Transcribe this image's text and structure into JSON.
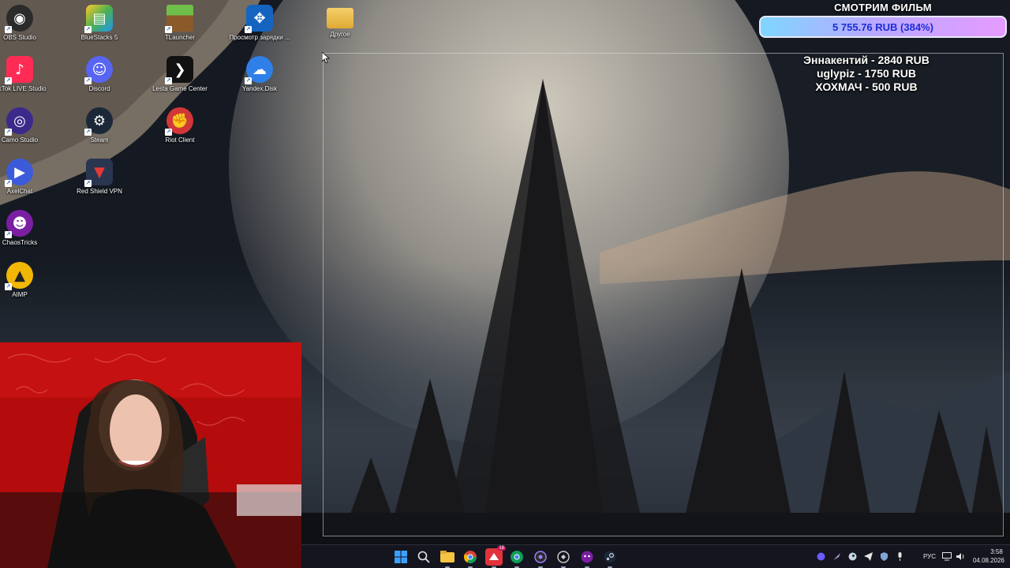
{
  "desktop": {
    "icons": [
      {
        "label": "OBS Studio",
        "icon": "obs-icon",
        "color": "#2b2b2b"
      },
      {
        "label": "BlueStacks 5",
        "icon": "bluestacks-icon",
        "color": "#4caf50"
      },
      {
        "label": "TLauncher",
        "icon": "tlauncher-icon",
        "color": "#5d8a3a"
      },
      {
        "label": "Просмотр зарядки ...",
        "icon": "controller-battery-icon",
        "color": "#1565c0"
      },
      {
        "label": "Другое",
        "icon": "folder-icon",
        "color": "#e8b84a"
      },
      {
        "label": "TikTok LIVE Studio",
        "icon": "tiktok-icon",
        "color": "#fe2c55"
      },
      {
        "label": "Discord",
        "icon": "discord-icon",
        "color": "#5865f2"
      },
      {
        "label": "Lesta Game Center",
        "icon": "lesta-icon",
        "color": "#111111"
      },
      {
        "label": "Yandex.Disk",
        "icon": "yandex-disk-icon",
        "color": "#2f7fe8"
      },
      {
        "label": "Camo Studio",
        "icon": "camo-icon",
        "color": "#3b2a8a"
      },
      {
        "label": "Steam",
        "icon": "steam-icon",
        "color": "#1b2838"
      },
      {
        "label": "Riot Client",
        "icon": "riot-icon",
        "color": "#d13639"
      },
      {
        "label": "AxelChat",
        "icon": "axelchat-icon",
        "color": "#3b5bdb"
      },
      {
        "label": "Red Shield VPN",
        "icon": "red-shield-icon",
        "color": "#c62828"
      },
      {
        "label": "ChaosTricks",
        "icon": "chaostricks-icon",
        "color": "#7b1fa2"
      },
      {
        "label": "AIMP",
        "icon": "aimp-icon",
        "color": "#f2b705"
      }
    ]
  },
  "overlay": {
    "goal_title": "СМОТРИМ ФИЛЬМ",
    "goal_amount": "5 755.76 RUB (384%)",
    "donors": [
      "Эннакентий - 2840 RUB",
      "uglypiz - 1750 RUB",
      "ХОХМАЧ - 500 RUB"
    ]
  },
  "taskbar": {
    "apps": [
      "start-icon",
      "search-icon",
      "file-explorer-icon",
      "chrome-icon",
      "streaming-app-icon",
      "chrome-alt-icon",
      "obs-icon",
      "app-icon",
      "chaostricks-icon",
      "steam-icon"
    ],
    "badge": "18",
    "tray": [
      "ai-app-icon",
      "feather-icon",
      "steam-icon",
      "telegram-icon",
      "shield-check-icon",
      "microphone-icon"
    ],
    "language": "РУС",
    "time": "3:58",
    "date": "04.08.2026"
  }
}
